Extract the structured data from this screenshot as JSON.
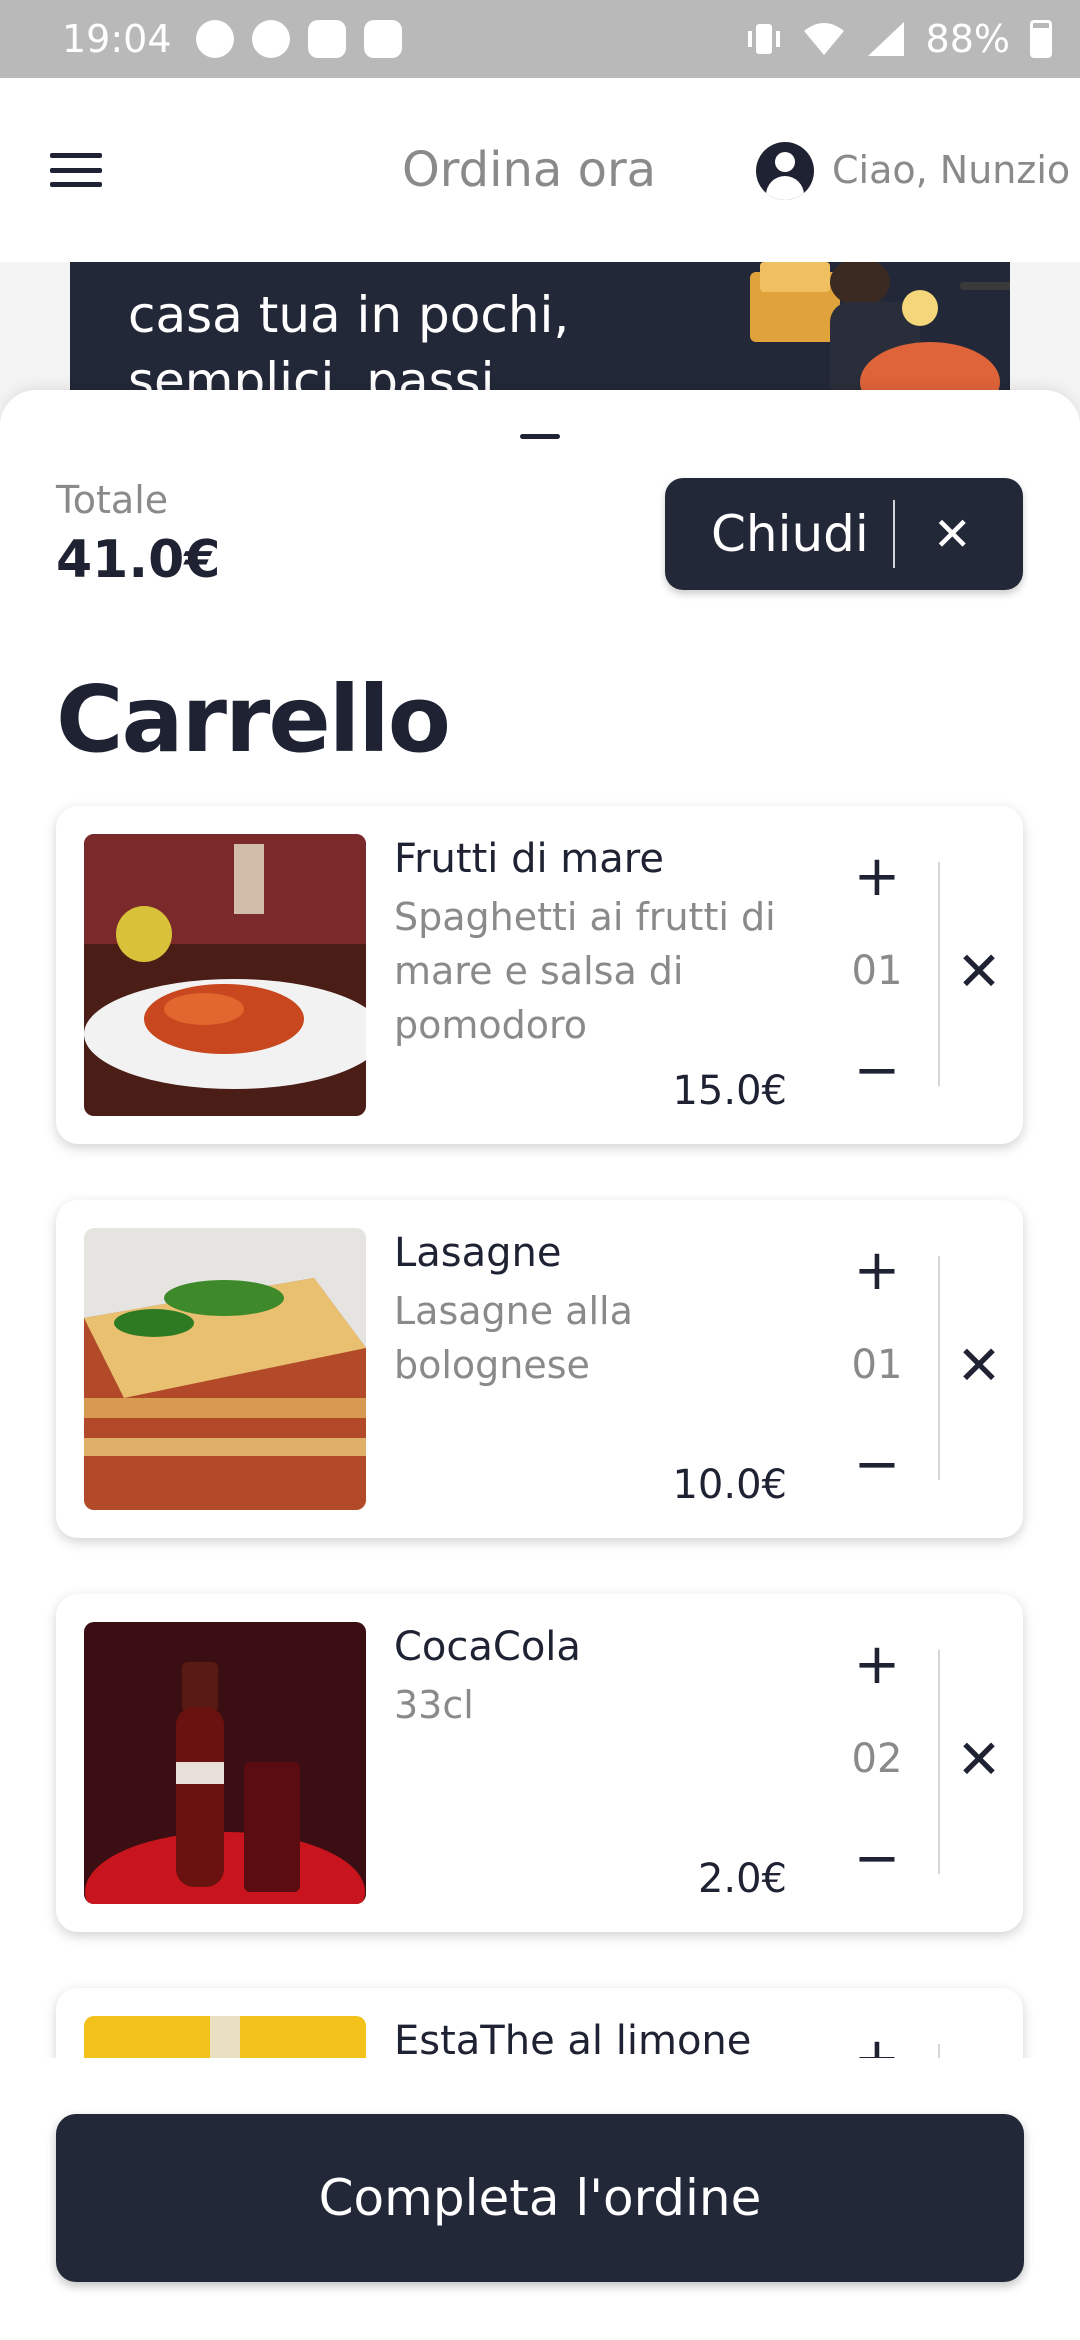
{
  "status_bar": {
    "time": "19:04",
    "battery": "88%",
    "left_icons": [
      "whatsapp-icon",
      "app-icon",
      "youtube-icon",
      "instagram-icon"
    ],
    "right_icons": [
      "vibrate-icon",
      "wifi-icon",
      "signal-icon",
      "battery-icon"
    ]
  },
  "app_bar": {
    "title": "Ordina ora",
    "greeting": "Ciao, Nunzio"
  },
  "banner": {
    "text": "casa tua in pochi, semplici, passi"
  },
  "cart": {
    "total_label": "Totale",
    "total_value": "41.0€",
    "close_label": "Chiudi",
    "title": "Carrello",
    "items": [
      {
        "name": "Frutti di mare",
        "description": "Spaghetti ai frutti di mare e salsa di pomodoro",
        "quantity": "01",
        "price": "15.0€"
      },
      {
        "name": "Lasagne",
        "description": "Lasagne alla bolognese",
        "quantity": "01",
        "price": "10.0€"
      },
      {
        "name": "CocaCola",
        "description": "33cl",
        "quantity": "02",
        "price": "2.0€"
      },
      {
        "name": "EstaThe al limone",
        "description": "",
        "quantity": "",
        "price": ""
      }
    ],
    "complete_button": "Completa l'ordine"
  },
  "colors": {
    "primary_dark": "#232838",
    "text_dark": "#1e2233",
    "text_muted": "#8a8a8a",
    "status_bar": "#b9b9b9"
  }
}
